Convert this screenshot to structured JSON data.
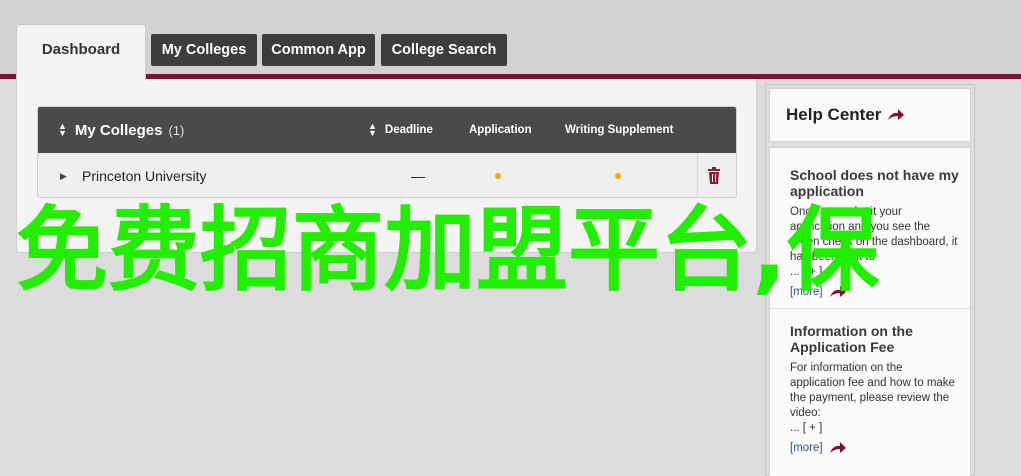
{
  "tabs": {
    "active": "Dashboard",
    "items": [
      "My Colleges",
      "Common App",
      "College Search"
    ]
  },
  "table": {
    "title": "My Colleges",
    "count": "(1)",
    "columns": [
      "Deadline",
      "Application",
      "Writing Supplement"
    ],
    "rows": [
      {
        "name": "Princeton University",
        "deadline": "—"
      }
    ]
  },
  "help": {
    "title": "Help Center",
    "articles": [
      {
        "title": "School does not have my application",
        "text": "Once you submit your application and you see the green check on the dashboard, it has been sent to",
        "plus": "... [ + ]",
        "more": "[more]"
      },
      {
        "title": "Information on the Application Fee",
        "text": "For information on the application fee and how to make the payment, please review the video:",
        "plus": "... [ + ]",
        "more": "[more]"
      }
    ]
  },
  "overlay": {
    "text": "免费招商加盟平台,保"
  },
  "colors": {
    "accent": "#7d1030",
    "dot": "#f2a900",
    "overlay": "#22ee00",
    "link": "#3a4e8c"
  }
}
